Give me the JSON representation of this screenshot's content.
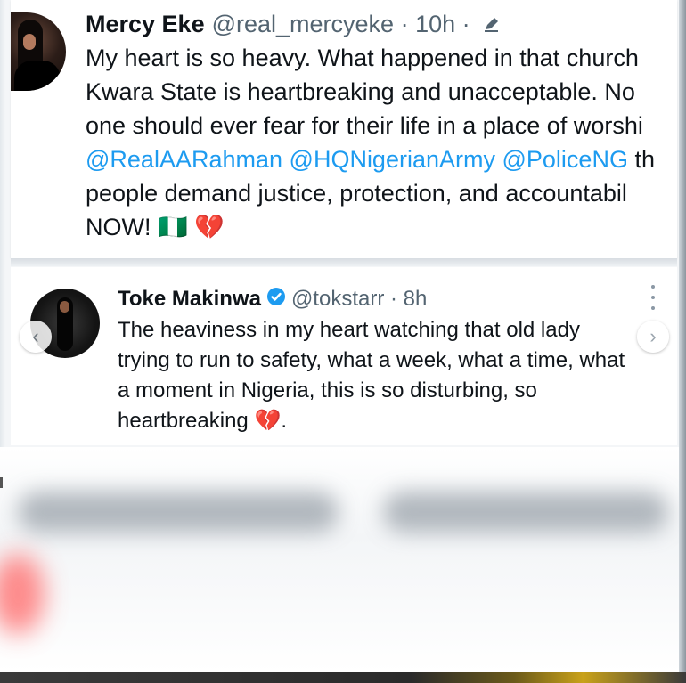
{
  "tweets": [
    {
      "name": "Mercy Eke",
      "handle": "@real_mercyeke",
      "time": "· 10h ·",
      "edit_icon": "pencil-icon",
      "lines": [
        {
          "text": "My heart is so heavy. What happened in that church"
        },
        {
          "text": "Kwara State is heartbreaking and unacceptable. No"
        },
        {
          "text": "one should ever fear for their life in a place of worshi"
        },
        {
          "m1": "@RealAARahman",
          "m2": "@HQNigerianArmy",
          "m3": "@PoliceNG",
          "tail": "th"
        },
        {
          "text": "people demand justice, protection, and accountabil"
        },
        {
          "text": "NOW!",
          "emoji": "🇳🇬 💔"
        }
      ]
    },
    {
      "name": "Toke Makinwa",
      "handle": "@tokstarr",
      "time": "· 8h",
      "verified_icon": "verified-badge-icon",
      "lines": [
        {
          "text": "The heaviness in my heart watching that old lady"
        },
        {
          "text": "trying to run to safety, what a week, what a time, what"
        },
        {
          "text": "a moment in Nigeria, this is so disturbing, so"
        },
        {
          "text": "heartbreaking",
          "emoji": "💔",
          "tail": "."
        }
      ]
    }
  ],
  "carousel": {
    "prev_icon": "‹",
    "next_icon": "›"
  },
  "colors": {
    "mention": "#1d9bf0",
    "verified": "#1d9bf0",
    "text": "#0f1419",
    "muted": "#536471"
  }
}
